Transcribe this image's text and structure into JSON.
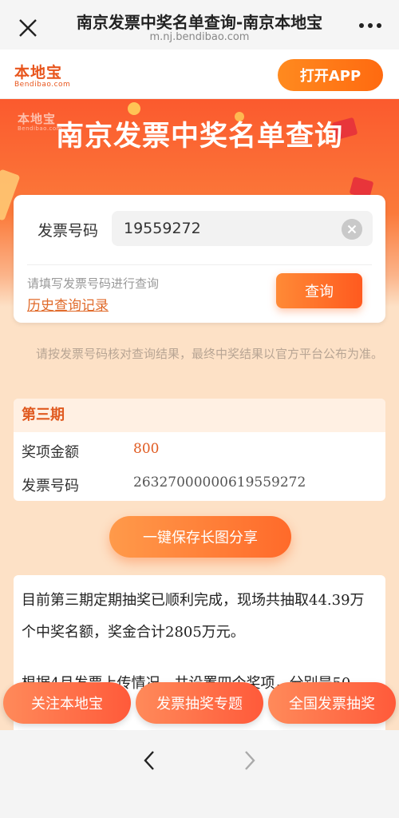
{
  "wx": {
    "title": "南京发票中奖名单查询-南京本地宝",
    "url": "m.nj.bendibao.com"
  },
  "header": {
    "logo_main": "本地宝",
    "logo_sub": "Bendibao.com",
    "open_app_label": "打开APP"
  },
  "banner": {
    "logo_main": "本地宝",
    "logo_sub": "Bendibao.com",
    "title": "南京发票中奖名单查询"
  },
  "query": {
    "label": "发票号码",
    "value": "19559272",
    "hint": "请填写发票号码进行查询",
    "history_label": "历史查询记录",
    "submit_label": "查询"
  },
  "notice": "请按发票号码核对查询结果，最终中奖结果以官方平台公布为准。",
  "result": {
    "period": "第三期",
    "amount_label": "奖项金额",
    "amount_value": "800",
    "code_label": "发票号码",
    "code_value": "26327000000619559272"
  },
  "share_label": "一键保存长图分享",
  "article": {
    "p1": "目前第三期定期抽奖已顺利完成，现场共抽取44.39万个中奖名额，奖金合计2805万元。",
    "p2": "根据4月发票上传情况，共设置四个奖项，分别是50"
  },
  "bottom_bar": {
    "items": [
      "关注本地宝",
      "发票抽奖专题",
      "全国发票抽奖"
    ]
  },
  "colors": {
    "accent": "#ff6a10",
    "banner": "#fb5a2e",
    "page_bg": "#fde1c6"
  }
}
